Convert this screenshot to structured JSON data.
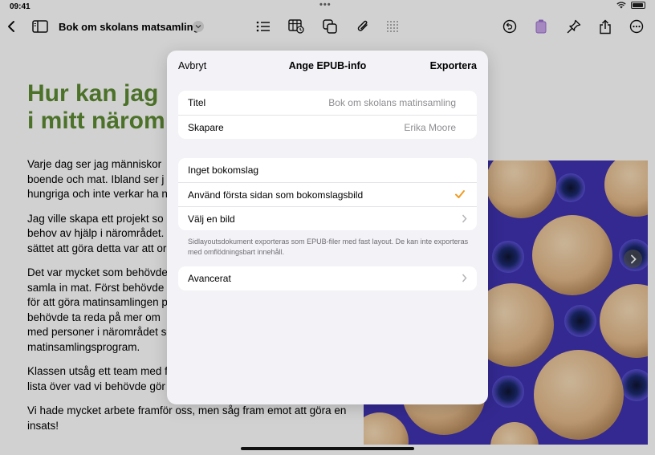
{
  "status_bar": {
    "time": "09:41"
  },
  "toolbar": {
    "document_title": "Bok om skolans matsamling",
    "icons": [
      "back-chevron-icon",
      "sidebar-icon",
      "list-icon",
      "table-icon",
      "shape-icon",
      "attachment-icon",
      "grid-icon",
      "undo-icon",
      "format-icon",
      "pin-icon",
      "share-icon",
      "more-icon"
    ]
  },
  "document": {
    "heading": "Hur kan jag\ni mitt närom",
    "paragraphs": [
      "Varje dag ser jag människor\nboende och mat. Ibland ser j\nhungriga och inte verkar ha n",
      "Jag ville skapa ett projekt so\nbehov av hjälp i närområdet.\nsättet att göra detta var att or",
      "Det var mycket som behövde\nsamla in mat. Först behövde\nför att göra matinsamlingen p\nbehövde ta reda på mer om\nmed personer i närområdet s\nmatinsamlingsprogram.",
      "Klassen utsåg ett team med f\nlista över vad vi behövde gör",
      "Vi hade mycket arbete framför oss, men såg fram emot att göra en\ninsats!"
    ]
  },
  "dialog": {
    "cancel_label": "Avbryt",
    "title": "Ange EPUB-info",
    "export_label": "Exportera",
    "fields": {
      "title_label": "Titel",
      "title_value": "Bok om skolans matinsamling",
      "creator_label": "Skapare",
      "creator_value": "Erika Moore"
    },
    "cover_options": {
      "no_cover": "Inget bokomslag",
      "first_page_cover": "Använd första sidan som bokomslagsbild",
      "first_page_selected": true,
      "choose_image": "Välj en bild"
    },
    "note": "Sidlayoutsdokument exporteras som EPUB-filer med fast layout. De kan inte exporteras med omflödningsbart innehåll.",
    "advanced_label": "Avancerat"
  },
  "colors": {
    "accent_check": "#f29a21",
    "heading_green": "#5d8a32",
    "photo_bg": "#3b2fa5"
  }
}
